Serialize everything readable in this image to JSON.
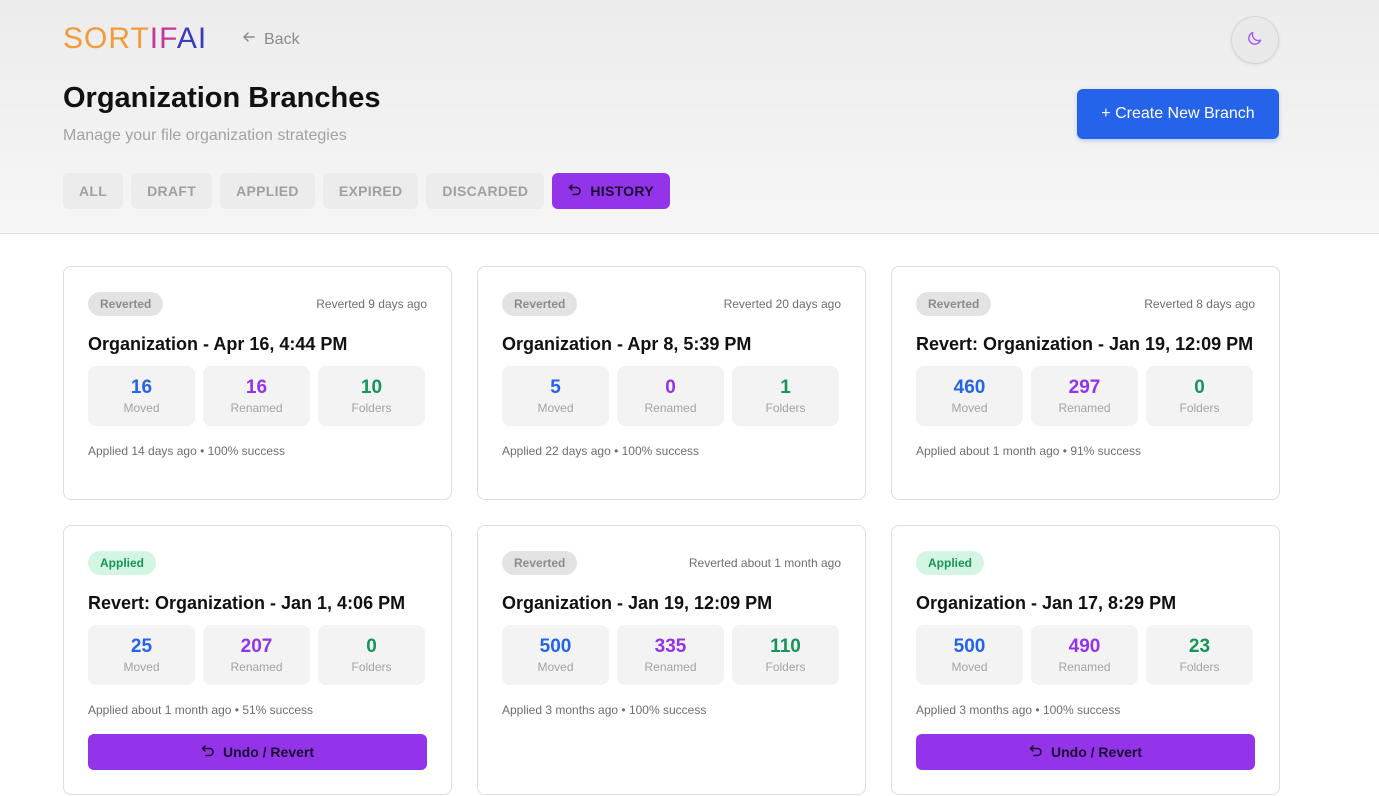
{
  "logo": {
    "part1": "SORT",
    "part2": "IF",
    "part3": "AI"
  },
  "nav": {
    "back_label": "Back"
  },
  "header": {
    "title": "Organization Branches",
    "subtitle": "Manage your file organization strategies",
    "create_label": "+ Create New Branch"
  },
  "tabs": [
    {
      "label": "ALL"
    },
    {
      "label": "DRAFT"
    },
    {
      "label": "APPLIED"
    },
    {
      "label": "EXPIRED"
    },
    {
      "label": "DISCARDED"
    },
    {
      "label": "HISTORY",
      "icon": "undo-icon"
    }
  ],
  "labels": {
    "moved": "Moved",
    "renamed": "Renamed",
    "folders": "Folders",
    "undo": "Undo / Revert"
  },
  "colors": {
    "accent_purple": "#9333ea",
    "primary_blue": "#2563eb",
    "success_green": "#16945a"
  },
  "cards": [
    {
      "status": "Reverted",
      "time": "Reverted 9 days ago",
      "title": "Organization - Apr 16, 4:44 PM",
      "moved": "16",
      "renamed": "16",
      "folders": "10",
      "meta": "Applied 14 days ago • 100% success"
    },
    {
      "status": "Reverted",
      "time": "Reverted 20 days ago",
      "title": "Organization - Apr 8, 5:39 PM",
      "moved": "5",
      "renamed": "0",
      "folders": "1",
      "meta": "Applied 22 days ago • 100% success"
    },
    {
      "status": "Reverted",
      "time": "Reverted 8 days ago",
      "title": "Revert: Organization - Jan 19, 12:09 PM",
      "moved": "460",
      "renamed": "297",
      "folders": "0",
      "meta": "Applied about 1 month ago • 91% success"
    },
    {
      "status": "Applied",
      "time": "",
      "title": "Revert: Organization - Jan 1, 4:06 PM",
      "moved": "25",
      "renamed": "207",
      "folders": "0",
      "meta": "Applied about 1 month ago • 51% success"
    },
    {
      "status": "Reverted",
      "time": "Reverted about 1 month ago",
      "title": "Organization - Jan 19, 12:09 PM",
      "moved": "500",
      "renamed": "335",
      "folders": "110",
      "meta": "Applied 3 months ago • 100% success"
    },
    {
      "status": "Applied",
      "time": "",
      "title": "Organization - Jan 17, 8:29 PM",
      "moved": "500",
      "renamed": "490",
      "folders": "23",
      "meta": "Applied 3 months ago • 100% success"
    }
  ]
}
